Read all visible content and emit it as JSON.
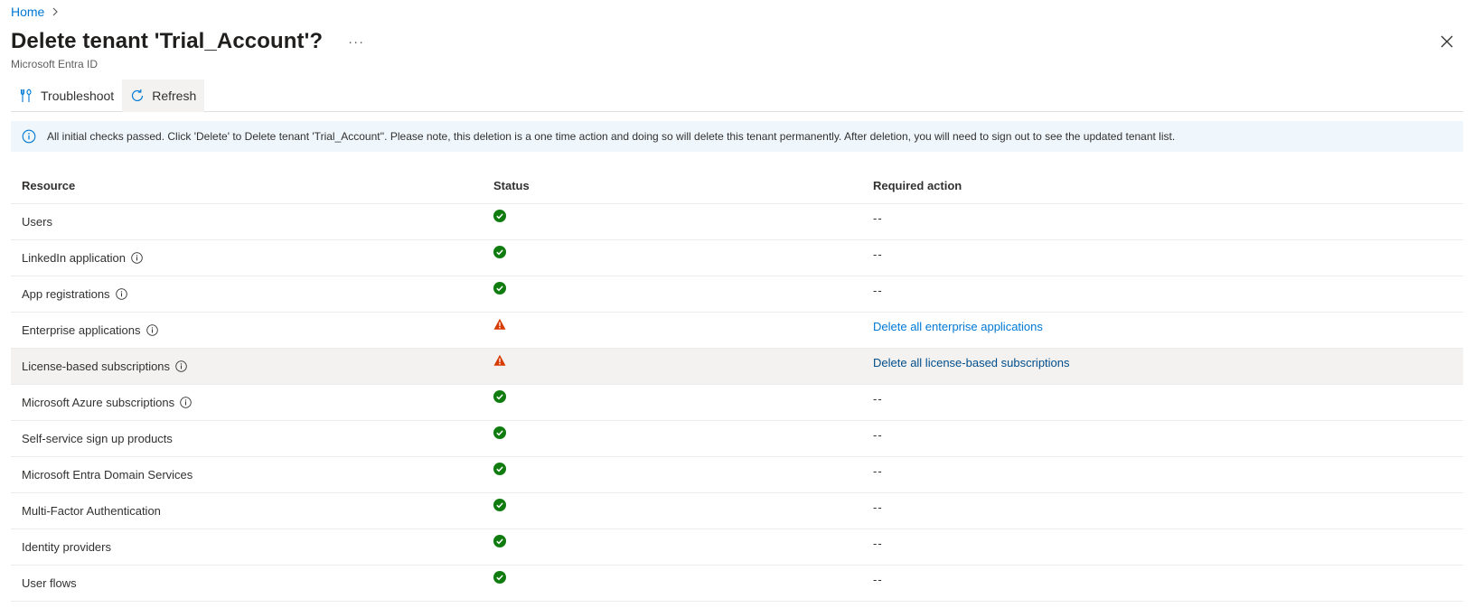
{
  "breadcrumb": {
    "home_label": "Home"
  },
  "header": {
    "title": "Delete tenant 'Trial_Account'?",
    "more_label": "···",
    "subtitle": "Microsoft Entra ID"
  },
  "toolbar": {
    "troubleshoot_label": "Troubleshoot",
    "refresh_label": "Refresh"
  },
  "info": {
    "message": "All initial checks passed. Click 'Delete' to Delete tenant 'Trial_Account''. Please note, this deletion is a one time action and doing so will delete this tenant permanently. After deletion, you will need to sign out to see the updated tenant list."
  },
  "table": {
    "headers": {
      "resource": "Resource",
      "status": "Status",
      "action": "Required action"
    },
    "rows": [
      {
        "resource": "Users",
        "status": "ok",
        "action": "--"
      },
      {
        "resource": "LinkedIn application",
        "status": "ok",
        "action": "--"
      },
      {
        "resource": "App registrations",
        "status": "ok",
        "action": "--"
      },
      {
        "resource": "Enterprise applications",
        "status": "warning",
        "action": "Delete all enterprise applications"
      },
      {
        "resource": "License-based subscriptions",
        "status": "warning",
        "action": "Delete all license-based subscriptions"
      },
      {
        "resource": "Microsoft Azure subscriptions",
        "status": "ok",
        "action": "--"
      },
      {
        "resource": "Self-service sign up products",
        "status": "ok",
        "action": "--"
      },
      {
        "resource": "Microsoft Entra Domain Services",
        "status": "ok",
        "action": "--"
      },
      {
        "resource": "Multi-Factor Authentication",
        "status": "ok",
        "action": "--"
      },
      {
        "resource": "Identity providers",
        "status": "ok",
        "action": "--"
      },
      {
        "resource": "User flows",
        "status": "ok",
        "action": "--"
      }
    ]
  },
  "colors": {
    "accent": "#0078d4",
    "success": "#107c10",
    "warning": "#d83b01",
    "info_bg": "#eff6fc"
  },
  "icons": {
    "breadcrumb_separator": "chevron-right-icon",
    "close": "close-icon",
    "troubleshoot": "troubleshoot-icon",
    "refresh": "refresh-icon",
    "info": "info-icon",
    "ok": "check-circle-icon",
    "warning": "warning-triangle-icon"
  }
}
